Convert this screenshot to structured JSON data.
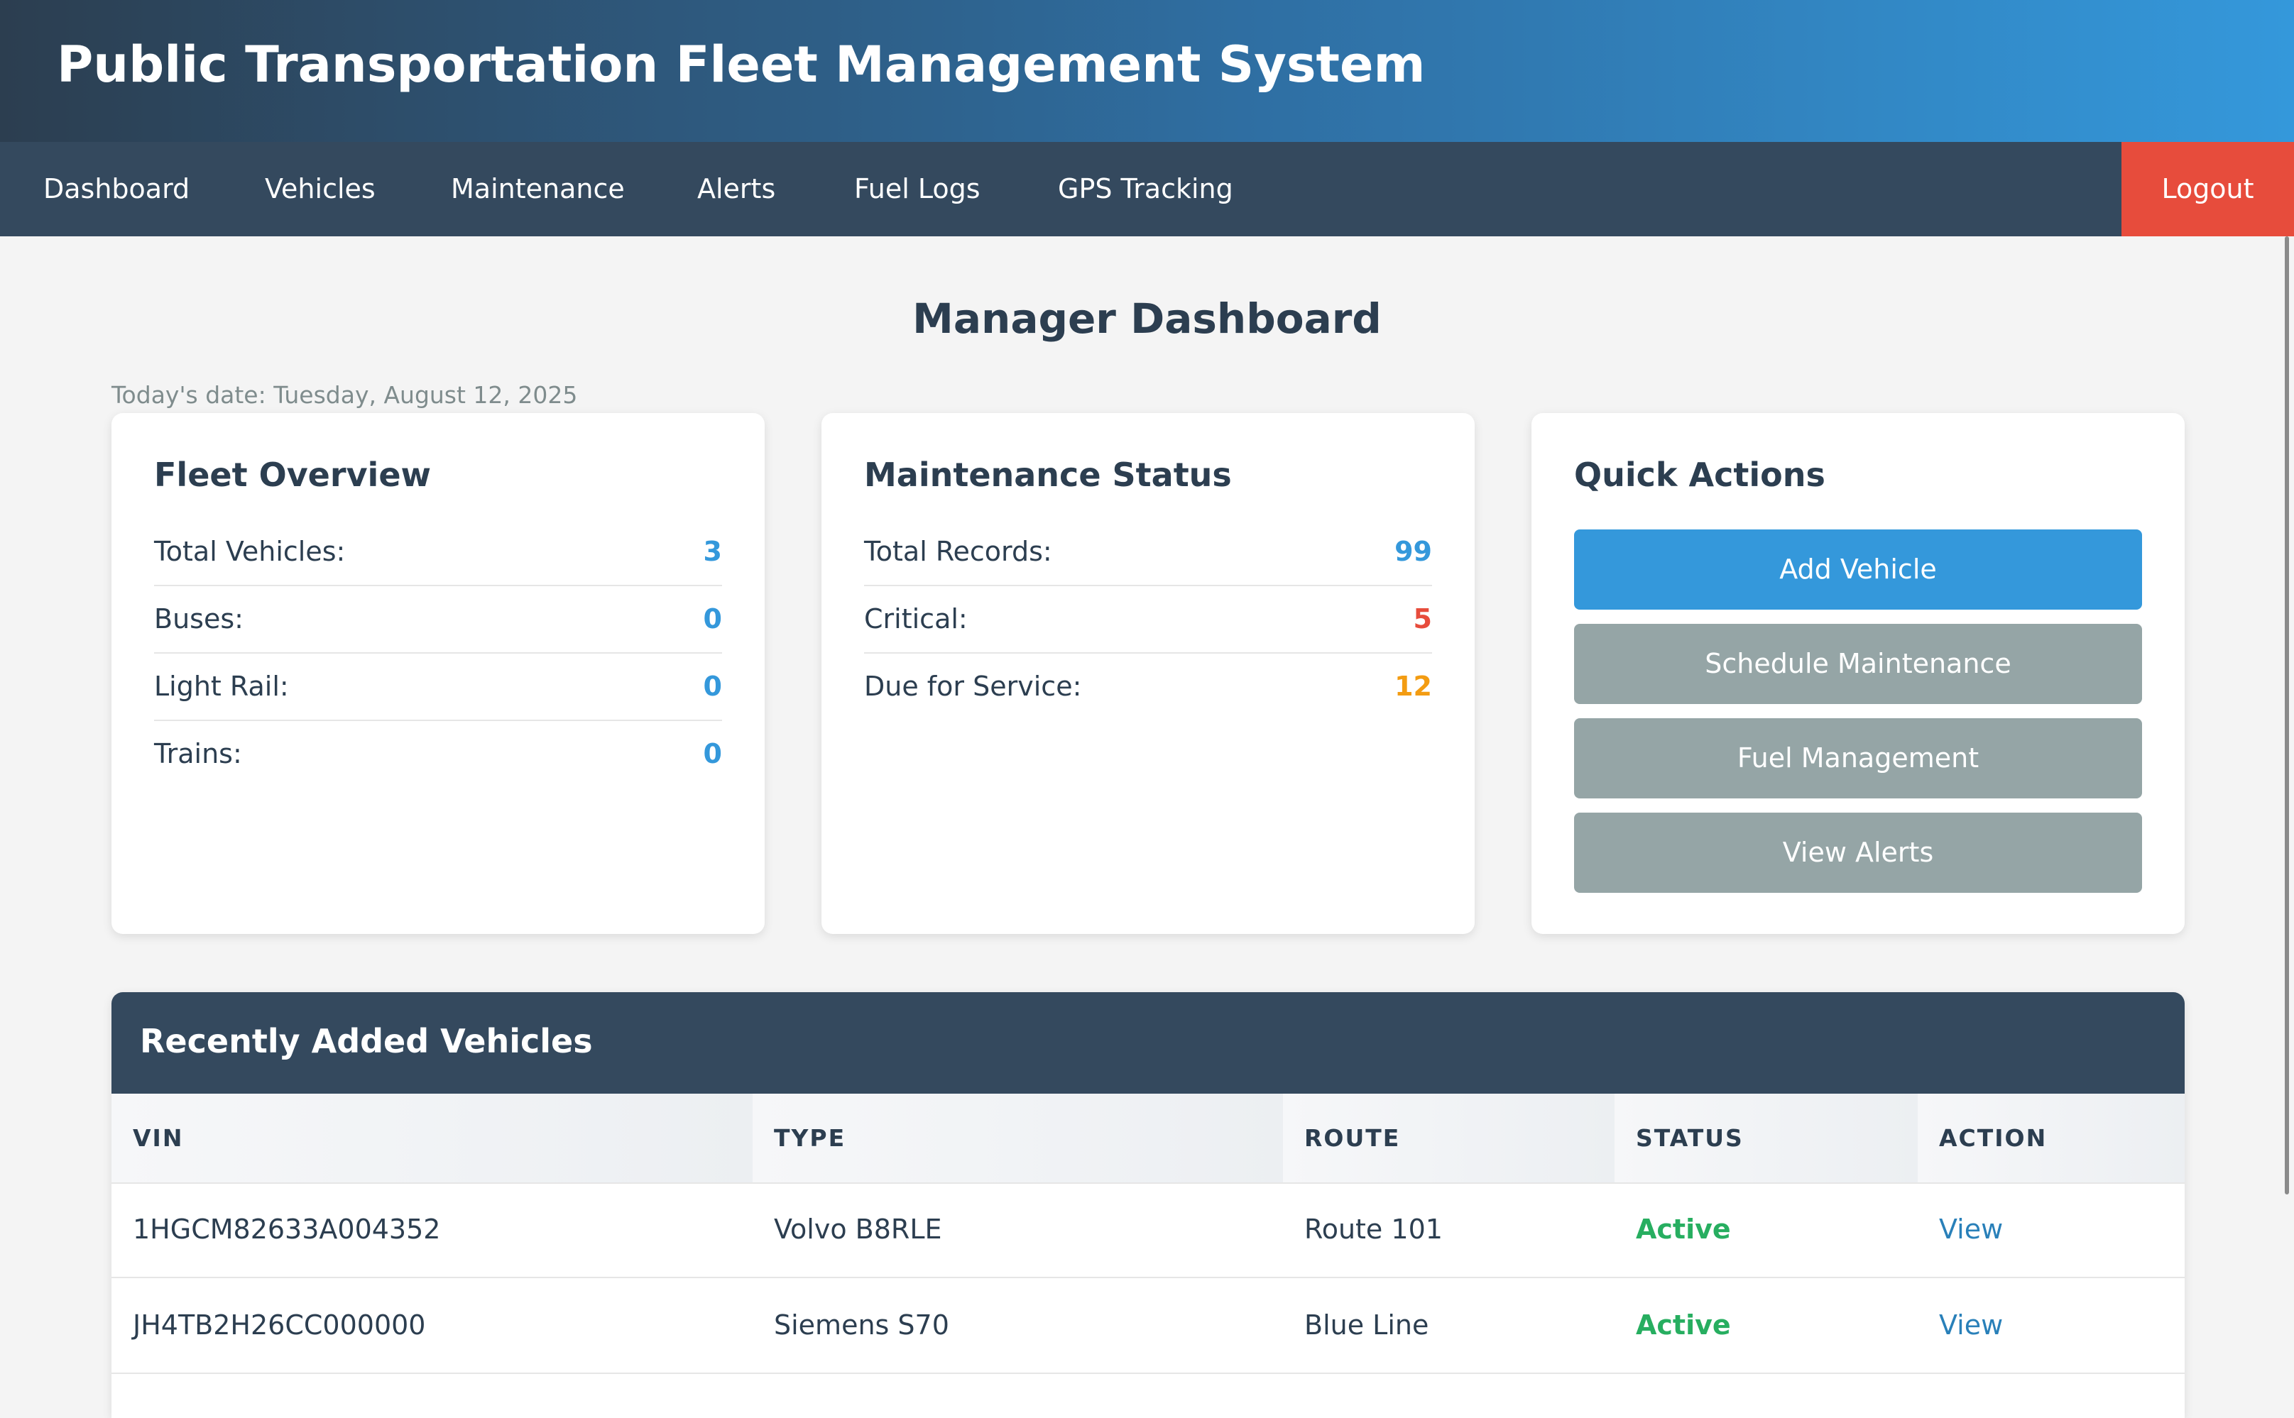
{
  "app": {
    "title": "Public Transportation Fleet Management System"
  },
  "nav": {
    "items": [
      {
        "label": "Dashboard"
      },
      {
        "label": "Vehicles"
      },
      {
        "label": "Maintenance"
      },
      {
        "label": "Alerts"
      },
      {
        "label": "Fuel Logs"
      },
      {
        "label": "GPS Tracking"
      }
    ],
    "logout_label": "Logout"
  },
  "page": {
    "title": "Manager Dashboard",
    "today": "Today's date: Tuesday, August 12, 2025"
  },
  "fleet_overview": {
    "title": "Fleet Overview",
    "rows": [
      {
        "label": "Total Vehicles:",
        "value": "3"
      },
      {
        "label": "Buses:",
        "value": "0"
      },
      {
        "label": "Light Rail:",
        "value": "0"
      },
      {
        "label": "Trains:",
        "value": "0"
      }
    ]
  },
  "maintenance_status": {
    "title": "Maintenance Status",
    "rows": [
      {
        "label": "Total Records:",
        "value": "99"
      },
      {
        "label": "Critical:",
        "value": "5"
      },
      {
        "label": "Due for Service:",
        "value": "12"
      }
    ]
  },
  "quick_actions": {
    "title": "Quick Actions",
    "buttons": [
      {
        "label": "Add Vehicle"
      },
      {
        "label": "Schedule Maintenance"
      },
      {
        "label": "Fuel Management"
      },
      {
        "label": "View Alerts"
      }
    ]
  },
  "recent_vehicles": {
    "title": "Recently Added Vehicles",
    "columns": [
      "VIN",
      "TYPE",
      "ROUTE",
      "STATUS",
      "ACTION"
    ],
    "rows": [
      {
        "vin": "1HGCM82633A004352",
        "type": "Volvo B8RLE",
        "route": "Route 101",
        "status": "Active",
        "action": "View"
      },
      {
        "vin": "JH4TB2H26CC000000",
        "type": "Siemens S70",
        "route": "Blue Line",
        "status": "Active",
        "action": "View"
      }
    ]
  },
  "colors": {
    "primary": "#3498db",
    "secondary": "#95a5a6",
    "danger": "#e74c3c",
    "warning": "#f39c12",
    "success": "#27ae60",
    "navy": "#34495e"
  }
}
